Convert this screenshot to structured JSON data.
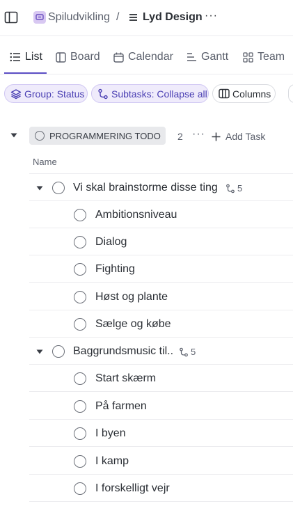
{
  "header": {
    "space_name": "Spiludvikling",
    "separator": "/",
    "list_name": "Lyd Design",
    "more": "···"
  },
  "tabs": [
    {
      "label": "List",
      "icon": "list-icon",
      "active": true
    },
    {
      "label": "Board",
      "icon": "board-icon"
    },
    {
      "label": "Calendar",
      "icon": "calendar-icon"
    },
    {
      "label": "Gantt",
      "icon": "gantt-icon"
    },
    {
      "label": "Team",
      "icon": "team-icon"
    }
  ],
  "toolbar": {
    "group_label": "Group: Status",
    "subtasks_label": "Subtasks: Collapse all",
    "columns_label": "Columns"
  },
  "group": {
    "status": "PROGRAMMERING TODO",
    "count": "2",
    "more": "···",
    "add_task": "Add Task"
  },
  "columns": {
    "name": "Name"
  },
  "tasks": [
    {
      "title": "Vi skal brainstorme disse ting",
      "subtask_count": "5",
      "subtasks": [
        "Ambitionsniveau",
        "Dialog",
        "Fighting",
        "Høst og plante",
        "Sælge og købe"
      ]
    },
    {
      "title": "Baggrundsmusic til..",
      "subtask_count": "5",
      "subtasks": [
        "Start skærm",
        "På farmen",
        "I byen",
        "I kamp",
        "I forskelligt vejr"
      ]
    }
  ],
  "colors": {
    "accent": "#5b4ec5",
    "chip_bg": "#efebfb",
    "status_pill_bg": "#e8e9ec",
    "text": "#2a2e34",
    "muted": "#5a5f6b"
  }
}
